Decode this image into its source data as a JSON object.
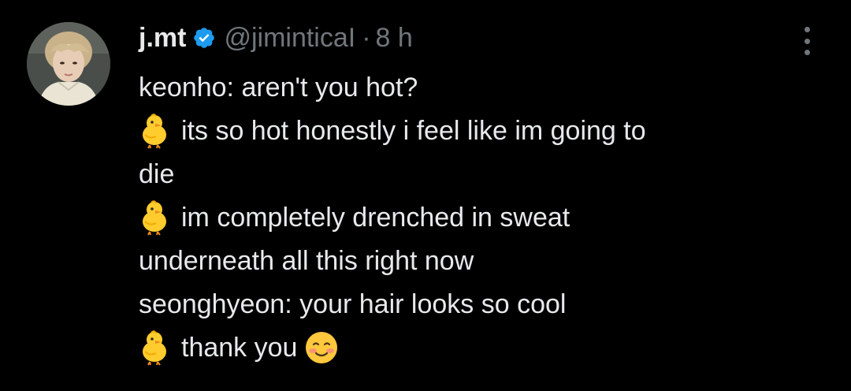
{
  "tweet": {
    "display_name": "j.mt",
    "handle": "@jiminticaI",
    "separator": "·",
    "time": "8 h",
    "verified": true,
    "accent_color": "#1d9bf0",
    "lines": {
      "l1": "keonho: aren't you hot?",
      "l2": "its so hot honestly i feel like im going to",
      "l3": "die",
      "l4": "im completely drenched in sweat",
      "l5": "underneath all this right now",
      "l6": "seonghyeon: your hair looks so cool",
      "l7": "thank you"
    },
    "icons": {
      "chick": "baby-chick-emoji",
      "blush": "smiling-face-emoji",
      "menu": "more-options-icon",
      "badge": "verified-badge-icon"
    }
  },
  "colors": {
    "background": "#000000",
    "text": "#e7e9ea",
    "secondary_text": "#71767b"
  }
}
